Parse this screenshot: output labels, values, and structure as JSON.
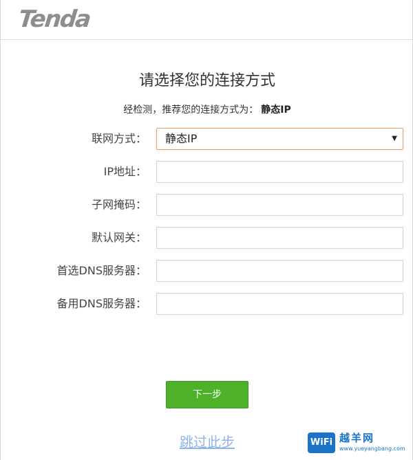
{
  "header": {
    "logo_text": "Tenda"
  },
  "main": {
    "title": "请选择您的连接方式",
    "detect_prefix": "经检测，推荐您的连接方式为：",
    "detect_value": "静态IP"
  },
  "form": {
    "connection_type": {
      "label": "联网方式：",
      "selected": "静态IP"
    },
    "ip_address": {
      "label": "IP地址：",
      "value": ""
    },
    "subnet_mask": {
      "label": "子网掩码：",
      "value": ""
    },
    "gateway": {
      "label": "默认网关：",
      "value": ""
    },
    "primary_dns": {
      "label": "首选DNS服务器：",
      "value": ""
    },
    "secondary_dns": {
      "label": "备用DNS服务器：",
      "value": ""
    }
  },
  "actions": {
    "next_label": "下一步",
    "skip_label": "跳过此步"
  },
  "watermark": {
    "badge": "WiFi",
    "text": "越羊网",
    "url": "www.yueyangbang.com"
  },
  "colors": {
    "button_green": "#4db12a",
    "select_focus_border": "#f0a070",
    "link_blue": "#8fb4e8",
    "logo_gray": "#8e8e8e"
  }
}
